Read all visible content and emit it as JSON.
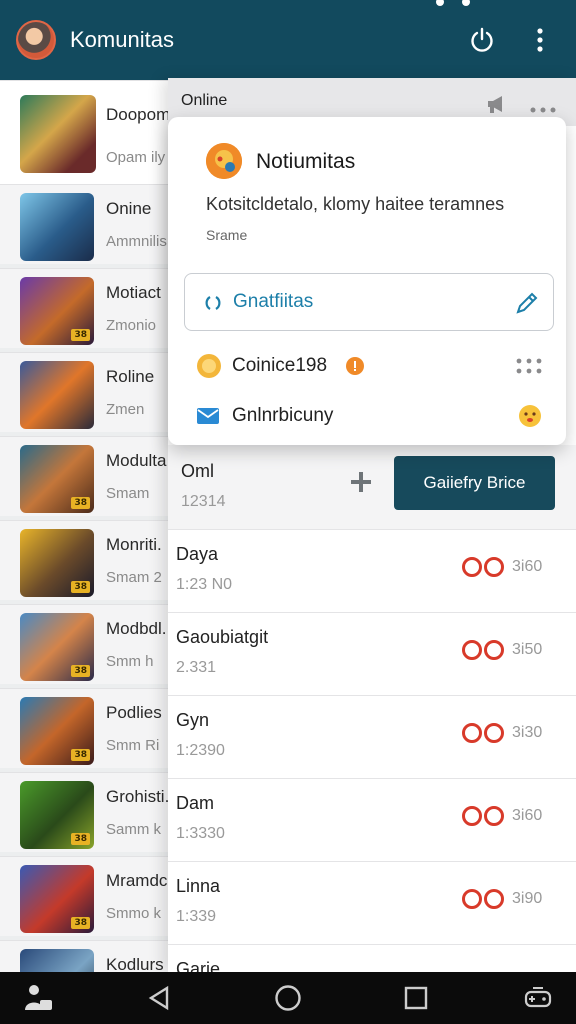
{
  "app": {
    "title": "Komunitas"
  },
  "colors": {
    "header": "#124a5e",
    "accent": "#174a5c",
    "link": "#1d7fa9",
    "ring": "#d83a2a"
  },
  "games": [
    {
      "name": "Doopom",
      "sub": "Opam ily",
      "badge": ""
    },
    {
      "name": "Onine",
      "sub": "Ammnilis",
      "badge": ""
    },
    {
      "name": "Motiact",
      "sub": "Zmonio",
      "badge": "38"
    },
    {
      "name": "Roline",
      "sub": "Zmen",
      "badge": ""
    },
    {
      "name": "Modulta",
      "sub": "Smam",
      "badge": "38"
    },
    {
      "name": "Monriti.",
      "sub": "Smam 2",
      "badge": "38"
    },
    {
      "name": "Modbdl.",
      "sub": "Smm h",
      "badge": "38"
    },
    {
      "name": "Podlies",
      "sub": "Smm Ri",
      "badge": "38"
    },
    {
      "name": "Grohisti.",
      "sub": "Samm k",
      "badge": "38"
    },
    {
      "name": "Mramdc",
      "sub": "Smmo k",
      "badge": "38"
    },
    {
      "name": "Kodlurs",
      "sub": "",
      "badge": ""
    }
  ],
  "panel": {
    "header_label": "Online"
  },
  "popup": {
    "title": "Notiumitas",
    "description": "Kotsitcldetalo, klomy haitee teramnes",
    "subtext": "Srame",
    "field_text": "Gnatfiitas",
    "row1_text": "Coinice198",
    "row2_text": "Gnlnrbicuny"
  },
  "featured": {
    "name": "Oml",
    "time": "12314",
    "action_label": "Gaiiefry Brice"
  },
  "players": [
    {
      "name": "Daya",
      "time": "1:23 N0",
      "count": "3i60"
    },
    {
      "name": "Gaoubiatgit",
      "time": "2.331",
      "count": "3i50"
    },
    {
      "name": "Gyn",
      "time": "1:2390",
      "count": "3i30"
    },
    {
      "name": "Dam",
      "time": "1:3330",
      "count": "3i60"
    },
    {
      "name": "Linna",
      "time": "1:339",
      "count": "3i90"
    },
    {
      "name": "Garie",
      "time": "",
      "count": ""
    }
  ]
}
